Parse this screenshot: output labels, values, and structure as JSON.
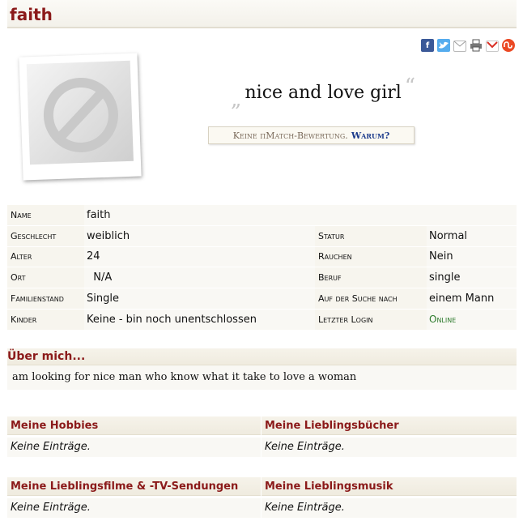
{
  "profile_name": "faith",
  "share_icons": [
    "facebook-icon",
    "twitter-icon",
    "mail-icon",
    "print-icon",
    "gmail-icon",
    "stumbleupon-icon"
  ],
  "motto": {
    "open_quote": "„",
    "text": "nice and love girl",
    "close_quote": "“"
  },
  "rating": {
    "text": "Keine πMatch-Bewertung.",
    "why_link": "Warum?"
  },
  "details": {
    "name_label": "Name",
    "name_value": "faith",
    "gender_label": "Geschlecht",
    "gender_value": "weiblich",
    "status_label": "Statur",
    "status_value": "Normal",
    "age_label": "Alter",
    "age_value": "24",
    "smoking_label": "Rauchen",
    "smoking_value": "Nein",
    "place_label": "Ort",
    "place_value": "  N/A",
    "job_label": "Beruf",
    "job_value": "single",
    "family_label": "Familienstand",
    "family_value": "Single",
    "search_label": "Auf der Suche nach",
    "search_value": "einem Mann",
    "kids_label": "Kinder",
    "kids_value": "Keine - bin noch unentschlossen",
    "login_label": "Letzter Login",
    "login_value": "Online"
  },
  "about": {
    "title": "Über mich...",
    "text": "am looking for nice man who know what it take to love a woman"
  },
  "sections": {
    "hobbies_title": "Meine Hobbies",
    "hobbies_value": "Keine Einträge.",
    "books_title": "Meine Lieblingsbücher",
    "books_value": "Keine Einträge.",
    "films_title": "Meine Lieblingsfilme & -TV-Sendungen",
    "films_value": "Keine Einträge.",
    "music_title": "Meine Lieblingsmusik",
    "music_value": "Keine Einträge."
  },
  "colors": {
    "title_red": "#8b1a1a",
    "online_green": "#2c7a2c",
    "link_blue": "#1c3b8c"
  }
}
